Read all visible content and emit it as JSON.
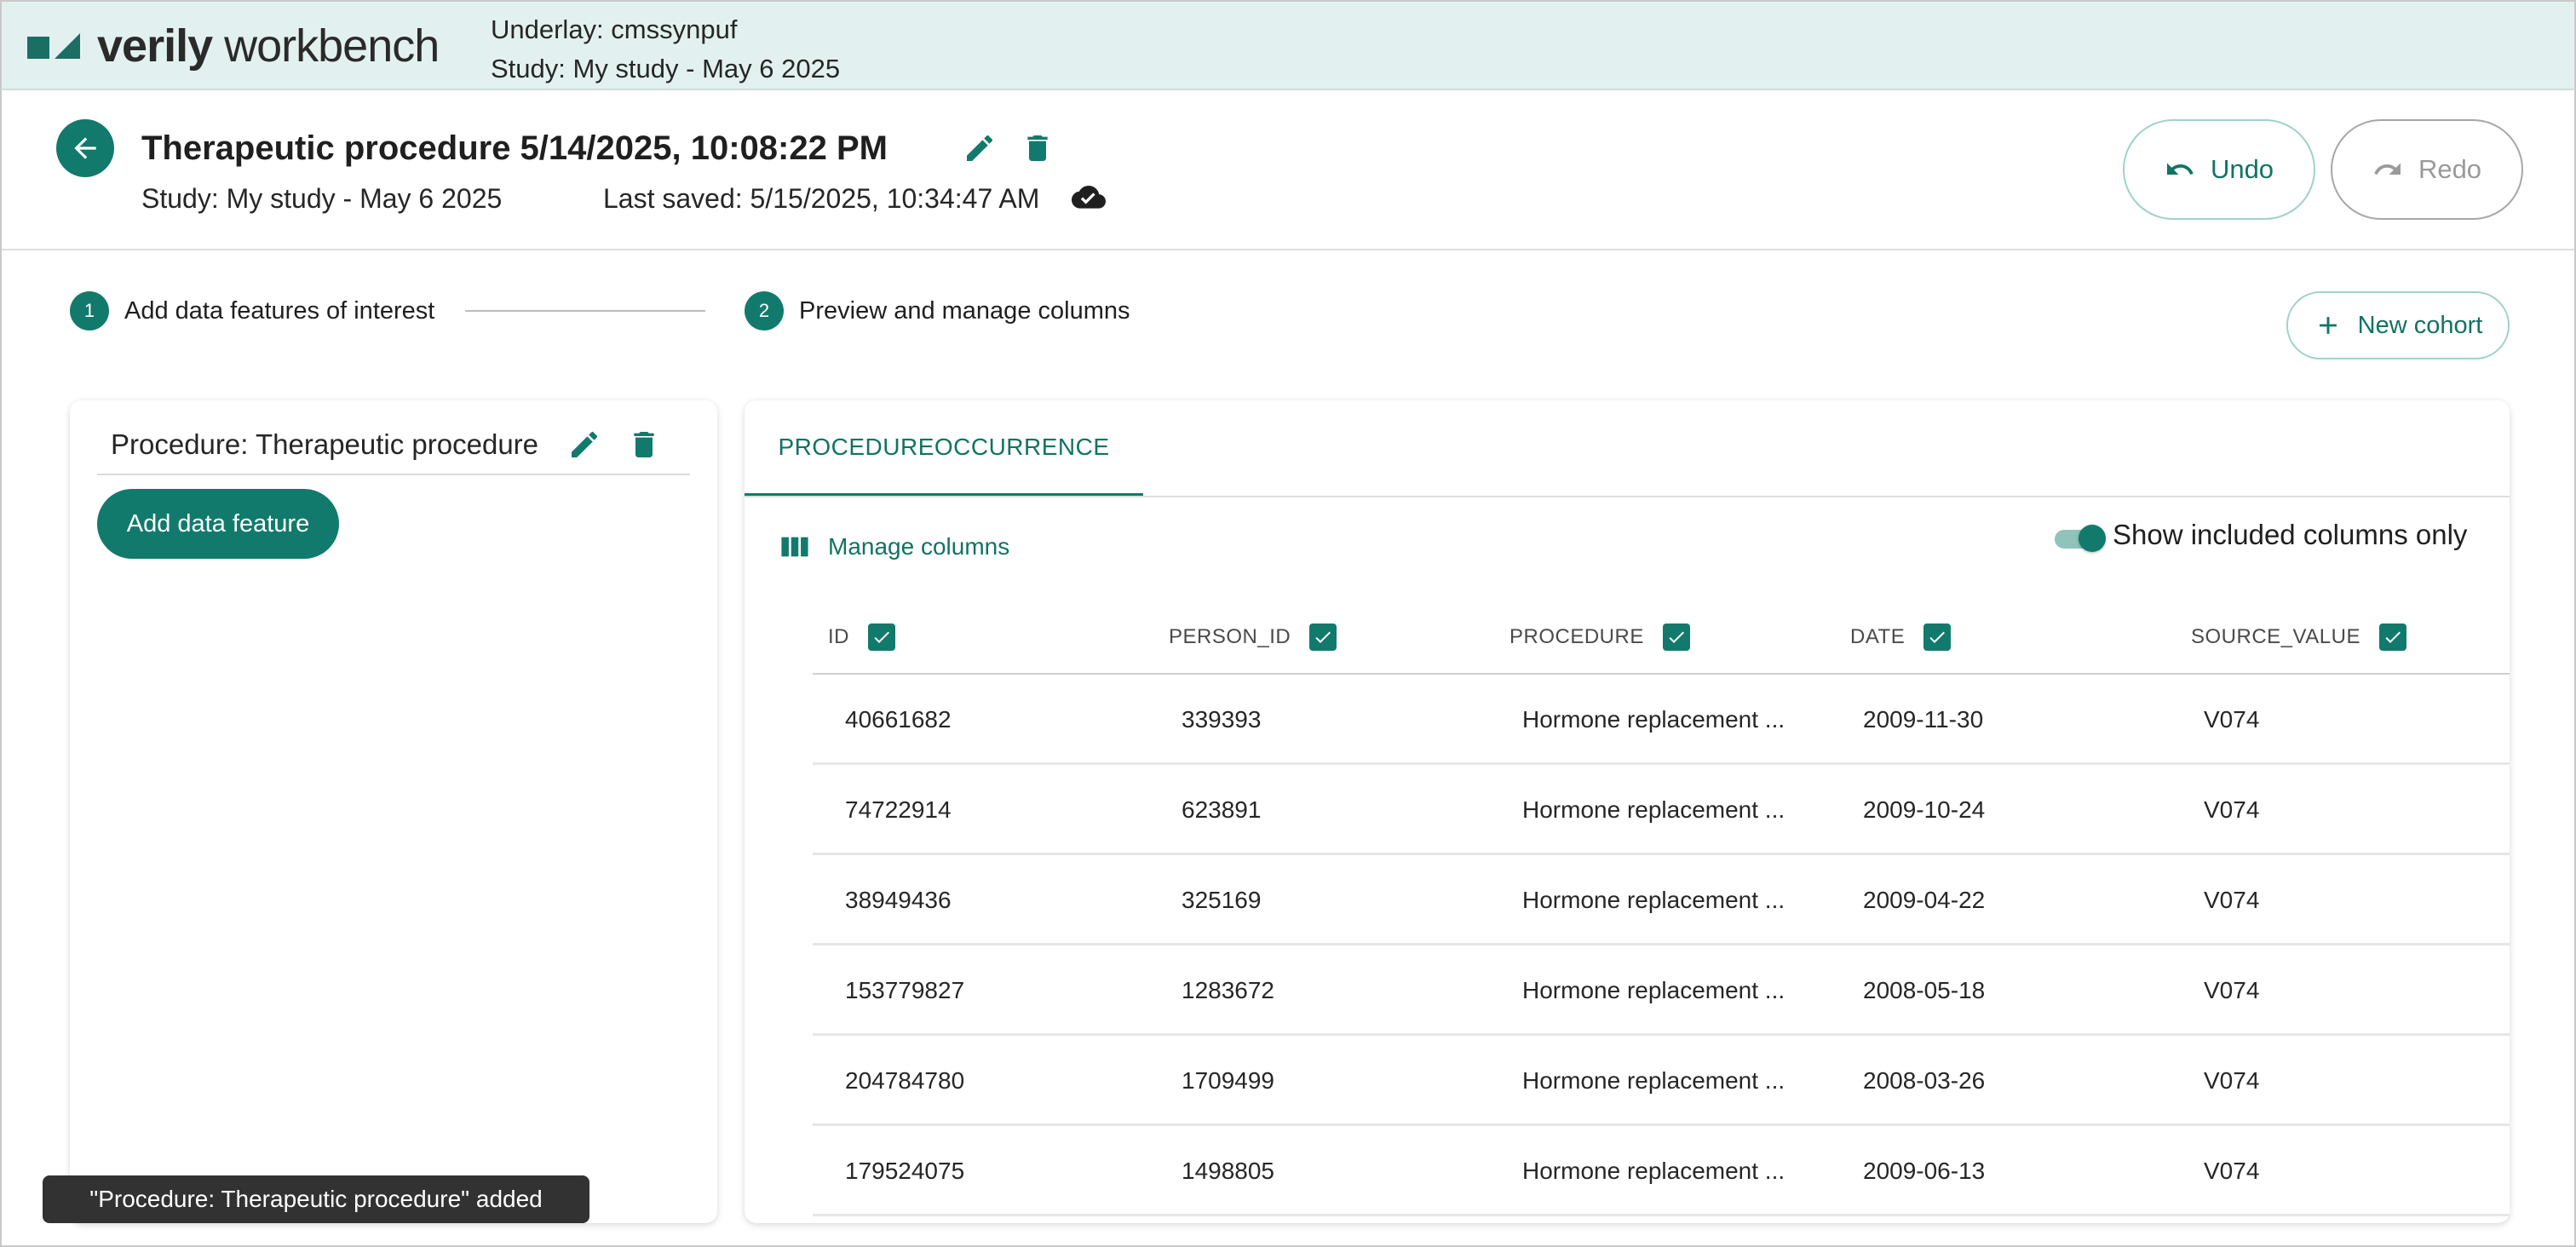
{
  "banner": {
    "logo_bold": "verily",
    "logo_light": "workbench",
    "underlay_line": "Underlay: cmssynpuf",
    "study_line": "Study: My study - May 6 2025"
  },
  "header": {
    "title": "Therapeutic procedure 5/14/2025, 10:08:22 PM",
    "study": "Study: My study - May 6 2025",
    "last_saved": "Last saved: 5/15/2025, 10:34:47 AM",
    "undo_label": "Undo",
    "redo_label": "Redo"
  },
  "stepper": {
    "steps": [
      {
        "number": "1",
        "label": "Add data features of interest"
      },
      {
        "number": "2",
        "label": "Preview and manage columns"
      }
    ],
    "new_cohort_label": "New cohort"
  },
  "left_panel": {
    "feature_label": "Procedure: Therapeutic procedure",
    "add_feature_label": "Add data feature"
  },
  "right_panel": {
    "tab_label": "PROCEDUREOCCURRENCE",
    "manage_columns_label": "Manage columns",
    "toggle_label": "Show included columns only",
    "toggle_on": true,
    "columns": [
      "ID",
      "PERSON_ID",
      "PROCEDURE",
      "DATE",
      "SOURCE_VALUE"
    ],
    "rows": [
      [
        "40661682",
        "339393",
        "Hormone replacement ...",
        "2009-11-30",
        "V074"
      ],
      [
        "74722914",
        "623891",
        "Hormone replacement ...",
        "2009-10-24",
        "V074"
      ],
      [
        "38949436",
        "325169",
        "Hormone replacement ...",
        "2009-04-22",
        "V074"
      ],
      [
        "153779827",
        "1283672",
        "Hormone replacement ...",
        "2008-05-18",
        "V074"
      ],
      [
        "204784780",
        "1709499",
        "Hormone replacement ...",
        "2008-03-26",
        "V074"
      ],
      [
        "179524075",
        "1498805",
        "Hormone replacement ...",
        "2009-06-13",
        "V074"
      ]
    ]
  },
  "snackbar": {
    "message": "\"Procedure: Therapeutic procedure\" added"
  },
  "colors": {
    "accent": "#127a6c",
    "banner_bg": "#e2f1ef",
    "snackbar_bg": "#323232"
  },
  "icons": [
    "back-arrow-icon",
    "edit-icon",
    "delete-icon",
    "cloud-done-icon",
    "undo-icon",
    "redo-icon",
    "plus-icon",
    "columns-icon",
    "checkbox-checked-icon"
  ]
}
